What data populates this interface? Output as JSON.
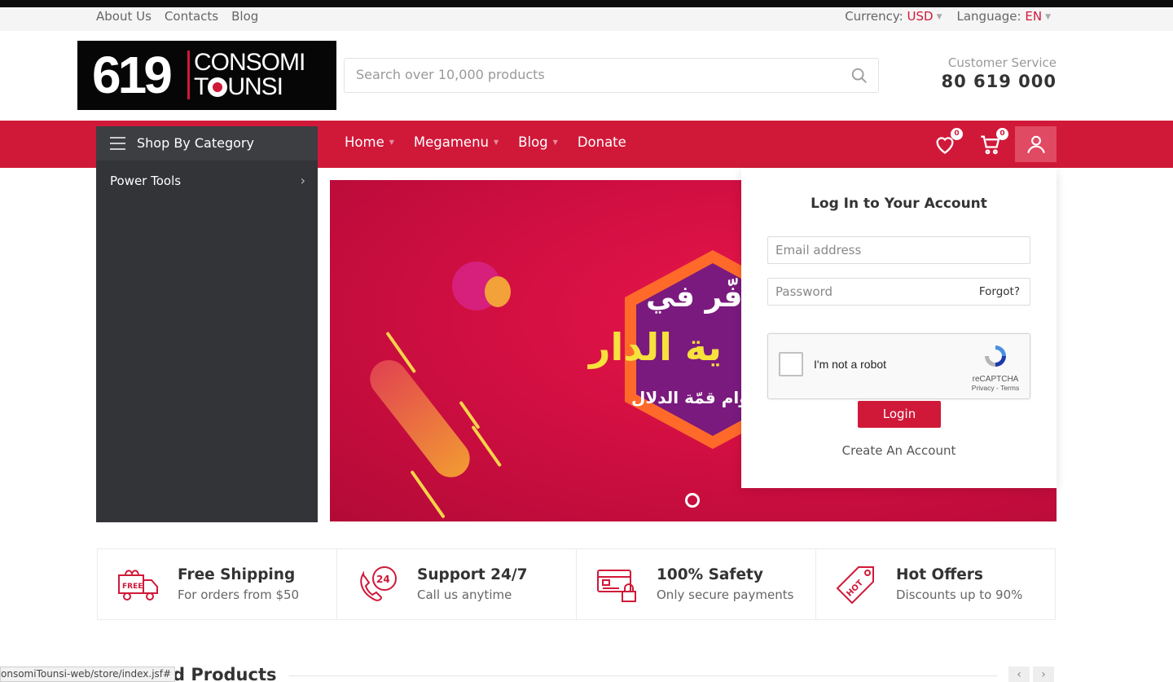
{
  "topbar": {
    "links": [
      "About Us",
      "Contacts",
      "Blog"
    ],
    "currency_label": "Currency:",
    "currency_value": "USD",
    "language_label": "Language:",
    "language_value": "EN"
  },
  "logo": {
    "number": "619",
    "line1": "CONSOMI",
    "line2_a": "T",
    "line2_b": "UNSI"
  },
  "search": {
    "placeholder": "Search over 10,000 products"
  },
  "customer_service": {
    "label": "Customer Service",
    "phone": "80 619 000"
  },
  "category": {
    "header": "Shop By Category",
    "items": [
      "Power Tools"
    ]
  },
  "nav": {
    "items": [
      "Home",
      "Megamenu",
      "Blog",
      "Donate"
    ]
  },
  "wishlist_count": "0",
  "cart_count": "0",
  "banner": {
    "line1": "وفّر في",
    "line2": "ية الدار",
    "line3": "سوام قمّة الدلال"
  },
  "login": {
    "title": "Log In to Your Account",
    "email_placeholder": "Email address",
    "password_placeholder": "Password",
    "forgot": "Forgot?",
    "captcha_text": "I'm not a robot",
    "captcha_brand": "reCAPTCHA",
    "captcha_links": "Privacy - Terms",
    "button": "Login",
    "create": "Create An Account"
  },
  "features": [
    {
      "title": "Free Shipping",
      "subtitle": "For orders from $50"
    },
    {
      "title": "Support 24/7",
      "subtitle": "Call us anytime"
    },
    {
      "title": "100% Safety",
      "subtitle": "Only secure payments"
    },
    {
      "title": "Hot Offers",
      "subtitle": "Discounts up to 90%"
    }
  ],
  "section_title": "d Products",
  "status_url": "onsomiTounsi-web/store/index.jsf#",
  "colors": {
    "brand_red": "#d01939",
    "dark_panel": "#333438"
  }
}
